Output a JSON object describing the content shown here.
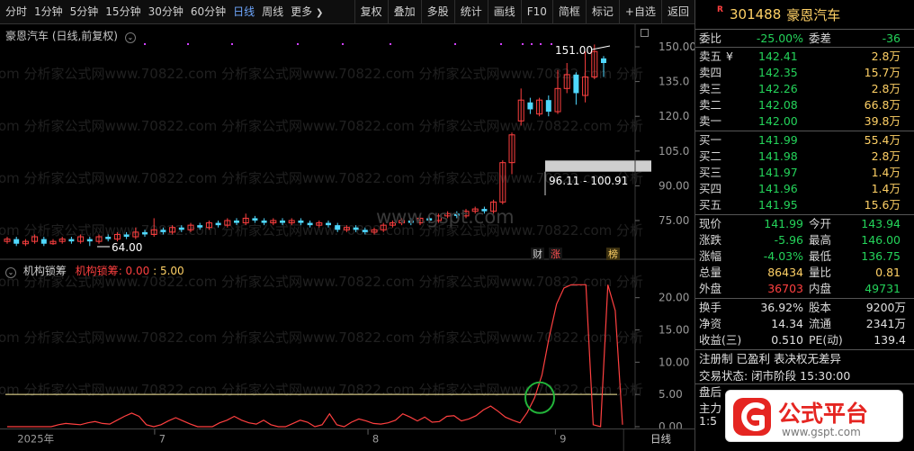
{
  "toolbar": {
    "periods": [
      "分时",
      "1分钟",
      "5分钟",
      "15分钟",
      "30分钟",
      "60分钟",
      "日线",
      "周线",
      "更多"
    ],
    "active_period": "日线",
    "more_arrow": "❯",
    "tools": [
      "复权",
      "叠加",
      "多股",
      "统计",
      "画线",
      "F10",
      "简框",
      "标记",
      "+自选",
      "返回"
    ]
  },
  "price_chart": {
    "title": "豪恩汽车 (日线,前复权)",
    "y_ticks": [
      "150.00",
      "135.0",
      "120.0",
      "105.0",
      "90.00",
      "75.00"
    ],
    "high_label": "151.00",
    "low_label": "64.00",
    "gap_label": "96.11 - 100.91",
    "event_tags": [
      {
        "text": "财",
        "color": "#d0d0d0"
      },
      {
        "text": "涨",
        "color": "#ff5050"
      },
      {
        "text": "榜",
        "color": "#ffd166"
      }
    ],
    "watermark_text": "www.gspt.com",
    "bg_watermark": "om 分析家公式网www.70822.com 分析家公式网www.70822.com 分析家公式网www.70822.com 分析"
  },
  "indicator": {
    "name": "机构锁筹",
    "line_name": "机构锁筹",
    "value": "0.00",
    "level": "5.00",
    "y_ticks": [
      "20.00",
      "15.00",
      "10.00",
      "5.00",
      "0.00"
    ]
  },
  "date_axis": {
    "labels": [
      "2025年",
      "7",
      "8",
      "9"
    ],
    "period_label": "日线"
  },
  "chart_data": {
    "type": "line",
    "title": "机构锁筹",
    "series": [
      {
        "name": "机构锁筹",
        "values": [
          0,
          0,
          0,
          0,
          0,
          0,
          0,
          0.3,
          0.5,
          0.4,
          0.3,
          0.6,
          0.8,
          0.5,
          0.4,
          1.0,
          1.6,
          2.1,
          1.6,
          0.3,
          0,
          0.3,
          0.9,
          1.4,
          0.9,
          0.4,
          0,
          0,
          0,
          0.6,
          1.0,
          1.6,
          1.0,
          0.6,
          0.4,
          1.0,
          0.3,
          0,
          0,
          0.5,
          1.0,
          0.7,
          0,
          0.3,
          2.0,
          0.3,
          0,
          0.7,
          1.2,
          0.9,
          0.5,
          0.4,
          0.6,
          1.0,
          2.0,
          1.5,
          0.9,
          1.5,
          0.7,
          0.8,
          1.6,
          1.7,
          0.9,
          1.2,
          1.7,
          2.6,
          3.2,
          2.4,
          1.5,
          1.0,
          0.6,
          2.2,
          4.5,
          8.0,
          14.0,
          19.0,
          21.5,
          22.0,
          22.0,
          22.0,
          0.3,
          0,
          22.0,
          18.0,
          0.3
        ]
      }
    ],
    "level_line": 5.0,
    "ylim": [
      0,
      24
    ],
    "xlabel": "",
    "ylabel": "",
    "grid": false
  },
  "quote": {
    "code": "301488",
    "name": "豪恩汽车",
    "r_mark": "R",
    "weibi_label": "委比",
    "weibi": "-25.00%",
    "weicha_label": "委差",
    "weicha": "-36",
    "sells": [
      {
        "label": "卖五",
        "currency": "¥",
        "price": "142.41",
        "vol": "2.8万"
      },
      {
        "label": "卖四",
        "currency": "",
        "price": "142.35",
        "vol": "15.7万"
      },
      {
        "label": "卖三",
        "currency": "",
        "price": "142.26",
        "vol": "2.8万"
      },
      {
        "label": "卖二",
        "currency": "",
        "price": "142.08",
        "vol": "66.8万"
      },
      {
        "label": "卖一",
        "currency": "",
        "price": "142.00",
        "vol": "39.8万"
      }
    ],
    "buys": [
      {
        "label": "买一",
        "price": "141.99",
        "vol": "55.4万"
      },
      {
        "label": "买二",
        "price": "141.98",
        "vol": "2.8万"
      },
      {
        "label": "买三",
        "price": "141.97",
        "vol": "1.4万"
      },
      {
        "label": "买四",
        "price": "141.96",
        "vol": "1.4万"
      },
      {
        "label": "买五",
        "price": "141.95",
        "vol": "15.6万"
      }
    ],
    "stats": [
      {
        "l1": "现价",
        "v1": "141.99",
        "c1": "green",
        "l2": "今开",
        "v2": "143.94",
        "c2": "green"
      },
      {
        "l1": "涨跌",
        "v1": "-5.96",
        "c1": "green",
        "l2": "最高",
        "v2": "146.00",
        "c2": "green"
      },
      {
        "l1": "涨幅",
        "v1": "-4.03%",
        "c1": "green",
        "l2": "最低",
        "v2": "136.75",
        "c2": "green"
      },
      {
        "l1": "总量",
        "v1": "86434",
        "c1": "yellow",
        "l2": "量比",
        "v2": "0.81",
        "c2": "yellow"
      },
      {
        "l1": "外盘",
        "v1": "36703",
        "c1": "red",
        "l2": "内盘",
        "v2": "49731",
        "c2": "green"
      }
    ],
    "info": [
      {
        "l1": "换手",
        "v1": "36.92%",
        "l2": "股本",
        "v2": "9200万"
      },
      {
        "l1": "净资",
        "v1": "14.34",
        "l2": "流通",
        "v2": "2341万"
      },
      {
        "l1": "收益(三)",
        "v1": "0.510",
        "l2": "PE(动)",
        "v2": "139.4"
      }
    ],
    "register_line": "注册制 已盈利 表决权无差异",
    "trade_status": "交易状态: 闭市阶段 15:30:00",
    "after_hours": "盘后",
    "main_force": "主力",
    "cut_text": "1:5"
  },
  "logo": {
    "text": "公式平台",
    "url_text": "www.gspt.com",
    "brand_color": "#e52521"
  }
}
